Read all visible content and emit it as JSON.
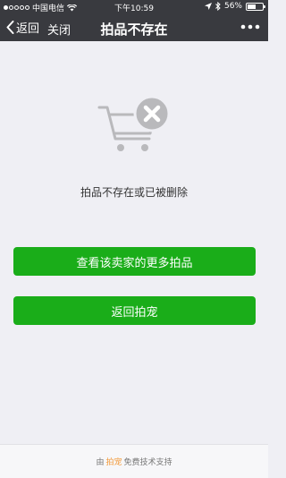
{
  "status_bar": {
    "carrier": "中国电信",
    "time": "下午10:59",
    "battery": "56%"
  },
  "nav": {
    "back_label": "返回",
    "close_label": "关闭",
    "title": "拍品不存在"
  },
  "main": {
    "message": "拍品不存在或已被删除",
    "primary_button": "查看该卖家的更多拍品",
    "secondary_button": "返回拍宠"
  },
  "footer": {
    "prefix": "由",
    "brand": "拍宠",
    "suffix": "免费技术支持"
  },
  "colors": {
    "nav_bg": "#393a3f",
    "page_bg": "#efeff4",
    "button_green": "#1aad19",
    "brand_orange": "#f39a3b",
    "icon_gray": "#b9b9bc"
  }
}
